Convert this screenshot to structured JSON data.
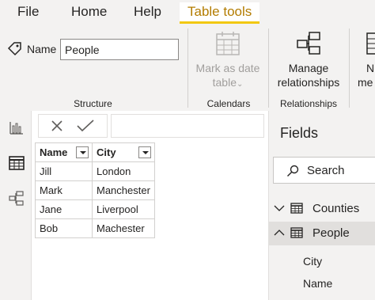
{
  "menu": {
    "file": "File",
    "home": "Home",
    "help": "Help",
    "table_tools": "Table tools"
  },
  "ribbon": {
    "name_label": "Name",
    "name_value": "People",
    "structure_label": "Structure",
    "mark_as_date_line1": "Mark as date",
    "mark_as_date_line2": "table",
    "calendars_label": "Calendars",
    "manage_line1": "Manage",
    "manage_line2": "relationships",
    "relationships_label": "Relationships",
    "cut_btn_line1": "N",
    "cut_btn_line2": "me"
  },
  "table": {
    "headers": [
      "Name",
      "City"
    ],
    "rows": [
      [
        "Jill",
        "London"
      ],
      [
        "Mark",
        "Manchester"
      ],
      [
        "Jane",
        "Liverpool"
      ],
      [
        "Bob",
        "Machester"
      ]
    ]
  },
  "fields": {
    "title": "Fields",
    "search_placeholder": "Search",
    "tables": [
      {
        "name": "Counties",
        "expanded": false
      },
      {
        "name": "People",
        "expanded": true,
        "columns": [
          "City",
          "Name"
        ]
      }
    ]
  },
  "colors": {
    "accent_yellow": "#f2c811",
    "accent_text": "#b37c00",
    "chrome_bg": "#f3f2f1"
  }
}
